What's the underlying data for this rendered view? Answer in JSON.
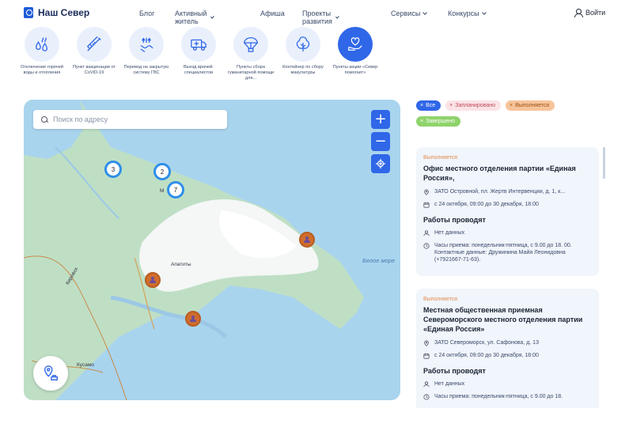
{
  "header": {
    "logo_text": "Наш Север",
    "menu": [
      {
        "label": "Блог",
        "dropdown": false
      },
      {
        "label": "Активный житель",
        "dropdown": true
      },
      {
        "label": "Афиша",
        "dropdown": false
      },
      {
        "label": "Проекты развития",
        "dropdown": true
      },
      {
        "label": "Сервисы",
        "dropdown": true
      },
      {
        "label": "Конкурсы",
        "dropdown": true
      }
    ],
    "login_label": "Войти"
  },
  "categories": [
    {
      "label": "Отключение горячей воды и отопления",
      "icon": "water-heat-icon"
    },
    {
      "label": "Пункт вакцинации от CoVID-19",
      "icon": "syringe-icon"
    },
    {
      "label": "Перевод на закрытую систему ГВС",
      "icon": "water-system-icon"
    },
    {
      "label": "Выезд врачей-специалистов",
      "icon": "ambulance-icon"
    },
    {
      "label": "Пункты сбора гуманитарной помощи для...",
      "icon": "parachute-icon"
    },
    {
      "label": "Контейнер по сбору макулатуры",
      "icon": "tree-icon"
    },
    {
      "label": "Пункты акции «Север помогает»",
      "icon": "heart-hand-icon",
      "active": true
    }
  ],
  "map": {
    "search_placeholder": "Поиск по адресу",
    "zoom_in": "+",
    "zoom_out": "−",
    "clusters": [
      "3",
      "2",
      "7"
    ],
    "place_labels": [
      "М",
      "Апатиты",
      "Кировск",
      "Кусамо"
    ],
    "sea_label": "Белое море"
  },
  "filters": [
    {
      "label": "Все",
      "bg": "#2f67e8",
      "color": "#ffffff"
    },
    {
      "label": "Запланировано",
      "bg": "#fbe3e6",
      "color": "#c04a5a"
    },
    {
      "label": "Выполняется",
      "bg": "#f7c49a",
      "color": "#9a4e16"
    },
    {
      "label": "Завершено",
      "bg": "#8fd36b",
      "color": "#ffffff"
    }
  ],
  "cards": [
    {
      "status": "Выполняется",
      "title": "Офис местного отделения партии «Единая Россия»,",
      "address": "ЗАТО Островной, пл. Жертв Интервенции, д. 1, к...",
      "dates": "с 24 октября, 09:00 до 30 декабря, 18:00",
      "work_heading": "Работы проводят",
      "executor": "Нет данных",
      "hours": "Часы приема: понедельник-пятница, с 9.00 до 18. 00. Контактные данные: Дружинина Майя Леонидовна (+7921667-71-63)."
    },
    {
      "status": "Выполняется",
      "title": "Местная общественная приемная Североморского местного отделения партии «Единая Россия»",
      "address": "ЗАТО Североморск, ул. Сафонова, д. 13",
      "dates": "с 24 октября, 09:00 до 30 декабря, 18:00",
      "work_heading": "Работы проводят",
      "executor": "Нет данных",
      "hours": "Часы приема: понедельник-пятница, с 9.00 до 18."
    }
  ]
}
